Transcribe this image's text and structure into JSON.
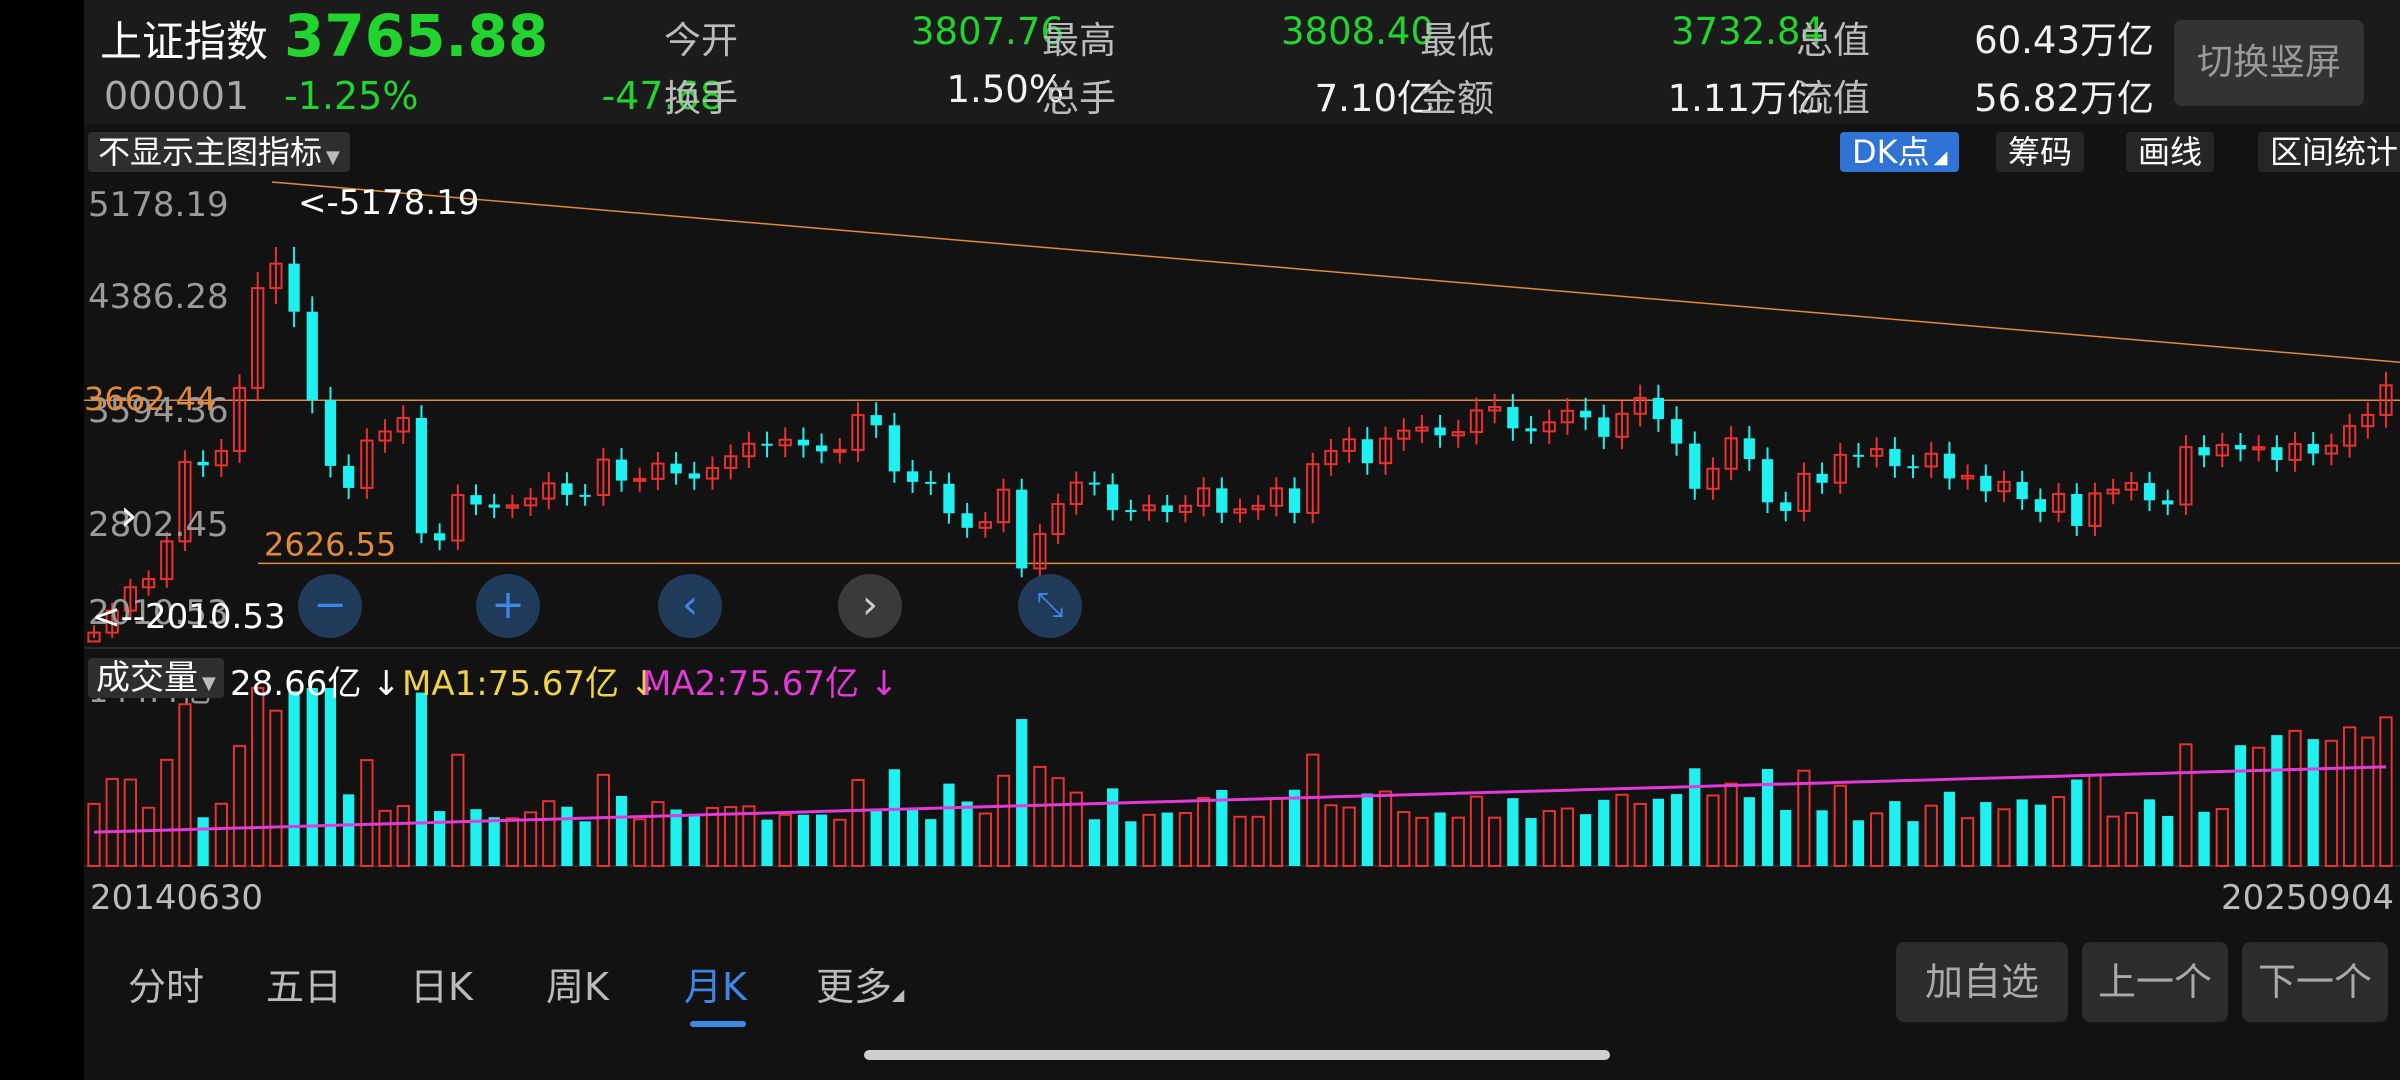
{
  "index": {
    "name": "上证指数",
    "price": "3765.88",
    "code": "000001",
    "pct": "-1.25%",
    "change": "-47.68"
  },
  "quotes": [
    {
      "label": "今开",
      "value": "3807.76",
      "color": "#22d42e"
    },
    {
      "label": "最高",
      "value": "3808.40",
      "color": "#22d42e"
    },
    {
      "label": "最低",
      "value": "3732.84",
      "color": "#22d42e"
    },
    {
      "label": "总值",
      "value": "60.43万亿",
      "color": "#f2f2f2"
    },
    {
      "label": "换手",
      "value": "1.50%",
      "color": "#f2f2f2"
    },
    {
      "label": "总手",
      "value": "7.10亿",
      "color": "#f2f2f2"
    },
    {
      "label": "金额",
      "value": "1.11万亿",
      "color": "#f2f2f2"
    },
    {
      "label": "流值",
      "value": "56.82万亿",
      "color": "#f2f2f2"
    }
  ],
  "rotate_button": "切换竖屏",
  "toolbar": {
    "main_indicator": "不显示主图指标",
    "dk": "DK点",
    "chips": "筹码",
    "draw": "画线",
    "range_stats": "区间统计"
  },
  "chart_labels": {
    "axis_ticks": [
      "5178.19",
      "4386.28",
      "3594.36",
      "2802.45",
      "2010.53"
    ],
    "max_marker": "<-5178.19",
    "min_marker": "<--2010.53",
    "ref_price": "3662.44",
    "low_ref": "2626.55"
  },
  "volume": {
    "selector": "成交量",
    "current": "28.66亿",
    "ma1": "MA1:75.67亿",
    "ma2": "MA2:75.67亿",
    "axis_max": "144.4亿"
  },
  "dates": {
    "start": "20140630",
    "end": "20250904"
  },
  "tabs": [
    "分时",
    "五日",
    "日K",
    "周K",
    "月K",
    "更多"
  ],
  "active_tab": 4,
  "buttons": {
    "add": "加自选",
    "prev": "上一个",
    "next": "下一个"
  },
  "colors": {
    "up": "#e8322f",
    "down": "#1ff0f0",
    "price_green": "#22d42e",
    "accent": "#3f86e6",
    "ref_line": "#e08a3c",
    "ma2": "#e23ad6",
    "ma1": "#f0d24a"
  },
  "chart_data": {
    "type": "candlestick",
    "period": "monthly",
    "x_range": [
      "20140630",
      "20250904"
    ],
    "y_range": [
      2010.53,
      5178.19
    ],
    "y_ticks": [
      5178.19,
      4386.28,
      3594.36,
      2802.45,
      2010.53
    ],
    "highest": 5178.19,
    "lowest": 2010.53,
    "reference_lines": [
      3662.44,
      2626.55
    ],
    "close_series": [
      2048,
      2201,
      2363,
      2420,
      2682,
      3234,
      3210,
      3310,
      3748,
      4441,
      4611,
      4277,
      3663,
      3206,
      3053,
      3382,
      3445,
      3539,
      2738,
      2688,
      3003,
      2938,
      2916,
      2932,
      2979,
      3085,
      3005,
      3004,
      3250,
      3104,
      3116,
      3222,
      3154,
      3118,
      3192,
      3273,
      3360,
      3349,
      3388,
      3348,
      3307,
      3317,
      3559,
      3488,
      3168,
      3095,
      3082,
      2877,
      2776,
      2815,
      3041,
      2494,
      2733,
      2941,
      3090,
      3078,
      2899,
      2898,
      2932,
      2886,
      2929,
      3050,
      2881,
      2905,
      2929,
      3050,
      2880,
      3218,
      3310,
      3391,
      3225,
      3395,
      3451,
      3473,
      3418,
      3441,
      3591,
      3615,
      3467,
      3446,
      3509,
      3589,
      3543,
      3408,
      3568,
      3678,
      3531,
      3361,
      3047,
      3186,
      3398,
      3253,
      2953,
      2893,
      3151,
      3089,
      3283,
      3276,
      3323,
      3204,
      3202,
      3291,
      3119,
      3137,
      3030,
      3095,
      2975,
      2887,
      3011,
      2789,
      3015,
      3041,
      3087,
      2967,
      2938,
      3336,
      3279,
      3351,
      3321,
      3336,
      3247,
      3358,
      3292,
      3347,
      3482,
      3560,
      3766
    ],
    "volume_axis_max": "144.4亿",
    "volume_current": "28.66亿",
    "ma1": "75.67亿",
    "ma2": "75.67亿"
  }
}
